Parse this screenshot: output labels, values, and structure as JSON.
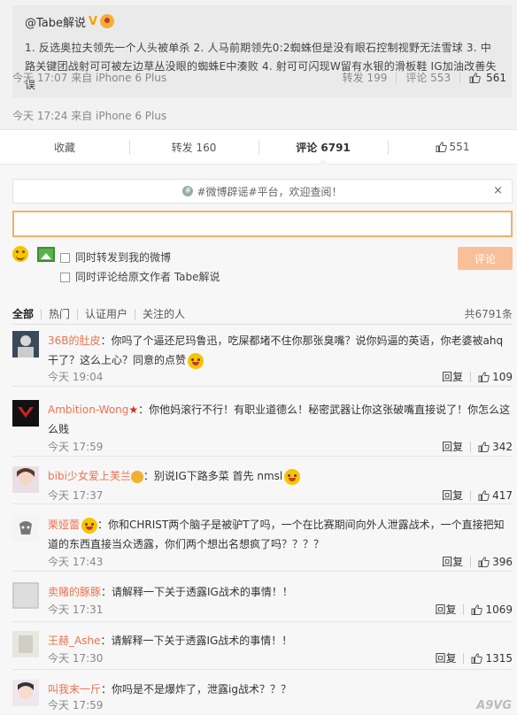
{
  "repost": {
    "author": "@Tabe解说",
    "badge": "V",
    "text": "1. 反选奥拉夫领先一个人头被单杀 2. 人马前期领先0:2蜘蛛但是没有眼石控制视野无法雪球 3. 中路关键团战射可可被左边草丛没眼的蜘蛛E中湊败 4. 射可可闪现W留有水银的滑板鞋 IG加油改善失误",
    "time": "今天 17:07 来自 iPhone 6 Plus",
    "repost_label": "转发 199",
    "comment_label": "评论 553",
    "likes": "561"
  },
  "original_time": "今天 17:24 来自 iPhone 6 Plus",
  "actions": {
    "favorite": "收藏",
    "repost": "转发 160",
    "comment": "评论 6791",
    "like": "551"
  },
  "notice": {
    "text": "#微博辟谣#平台，欢迎查阅！",
    "close": "×"
  },
  "options": {
    "repost_to_mine": "同时转发到我的微博",
    "comment_to_author": "同时评论给原文作者 Tabe解说",
    "submit": "评论"
  },
  "filters": {
    "all": "全部",
    "hot": "热门",
    "verified": "认证用户",
    "following": "关注的人",
    "total": "共6791条"
  },
  "comments": [
    {
      "name": "36B的肚皮",
      "text": "：你吗了个逼还尼玛鲁迅，吃屎都堵不住你那张臭嘴？说你妈逼的英语，你老婆被ahq干了？这么上心？同意的点赞",
      "time": "今天 19:04",
      "reply": "回复",
      "likes": "109"
    },
    {
      "name": "Ambition-Wong",
      "text": "：你他妈滚行不行！有职业道德么！秘密武器让你这张破嘴直接说了！你怎么这么贱",
      "time": "今天 17:59",
      "reply": "回复",
      "likes": "342"
    },
    {
      "name": "bibi少女爱上芙兰",
      "text": "：别说IG下路多菜 首先 nmsl",
      "time": "今天 17:37",
      "reply": "回复",
      "likes": "417"
    },
    {
      "name": "栗娅蕾",
      "text": "：你和CHRIST两个脑子是被驴T了吗，一个在比赛期间向外人泄露战术，一个直接把知道的东西直接当众透露，你们两个想出名想疯了吗？？？？",
      "time": "今天 17:43",
      "reply": "回复",
      "likes": "396"
    },
    {
      "name": "卖赌的豚豚",
      "text": "：请解释一下关于透露IG战术的事情！！",
      "time": "今天 17:31",
      "reply": "回复",
      "likes": "1069"
    },
    {
      "name": "王赫_Ashe",
      "text": "：请解释一下关于透露IG战术的事情！！",
      "time": "今天 17:30",
      "reply": "回复",
      "likes": "1315"
    },
    {
      "name": "叫我末一斤",
      "text": "：你吗是不是爆炸了，泄露ig战术？？？",
      "time": "今天 17:59",
      "reply": "",
      "likes": ""
    }
  ],
  "watermark": "A9VG"
}
